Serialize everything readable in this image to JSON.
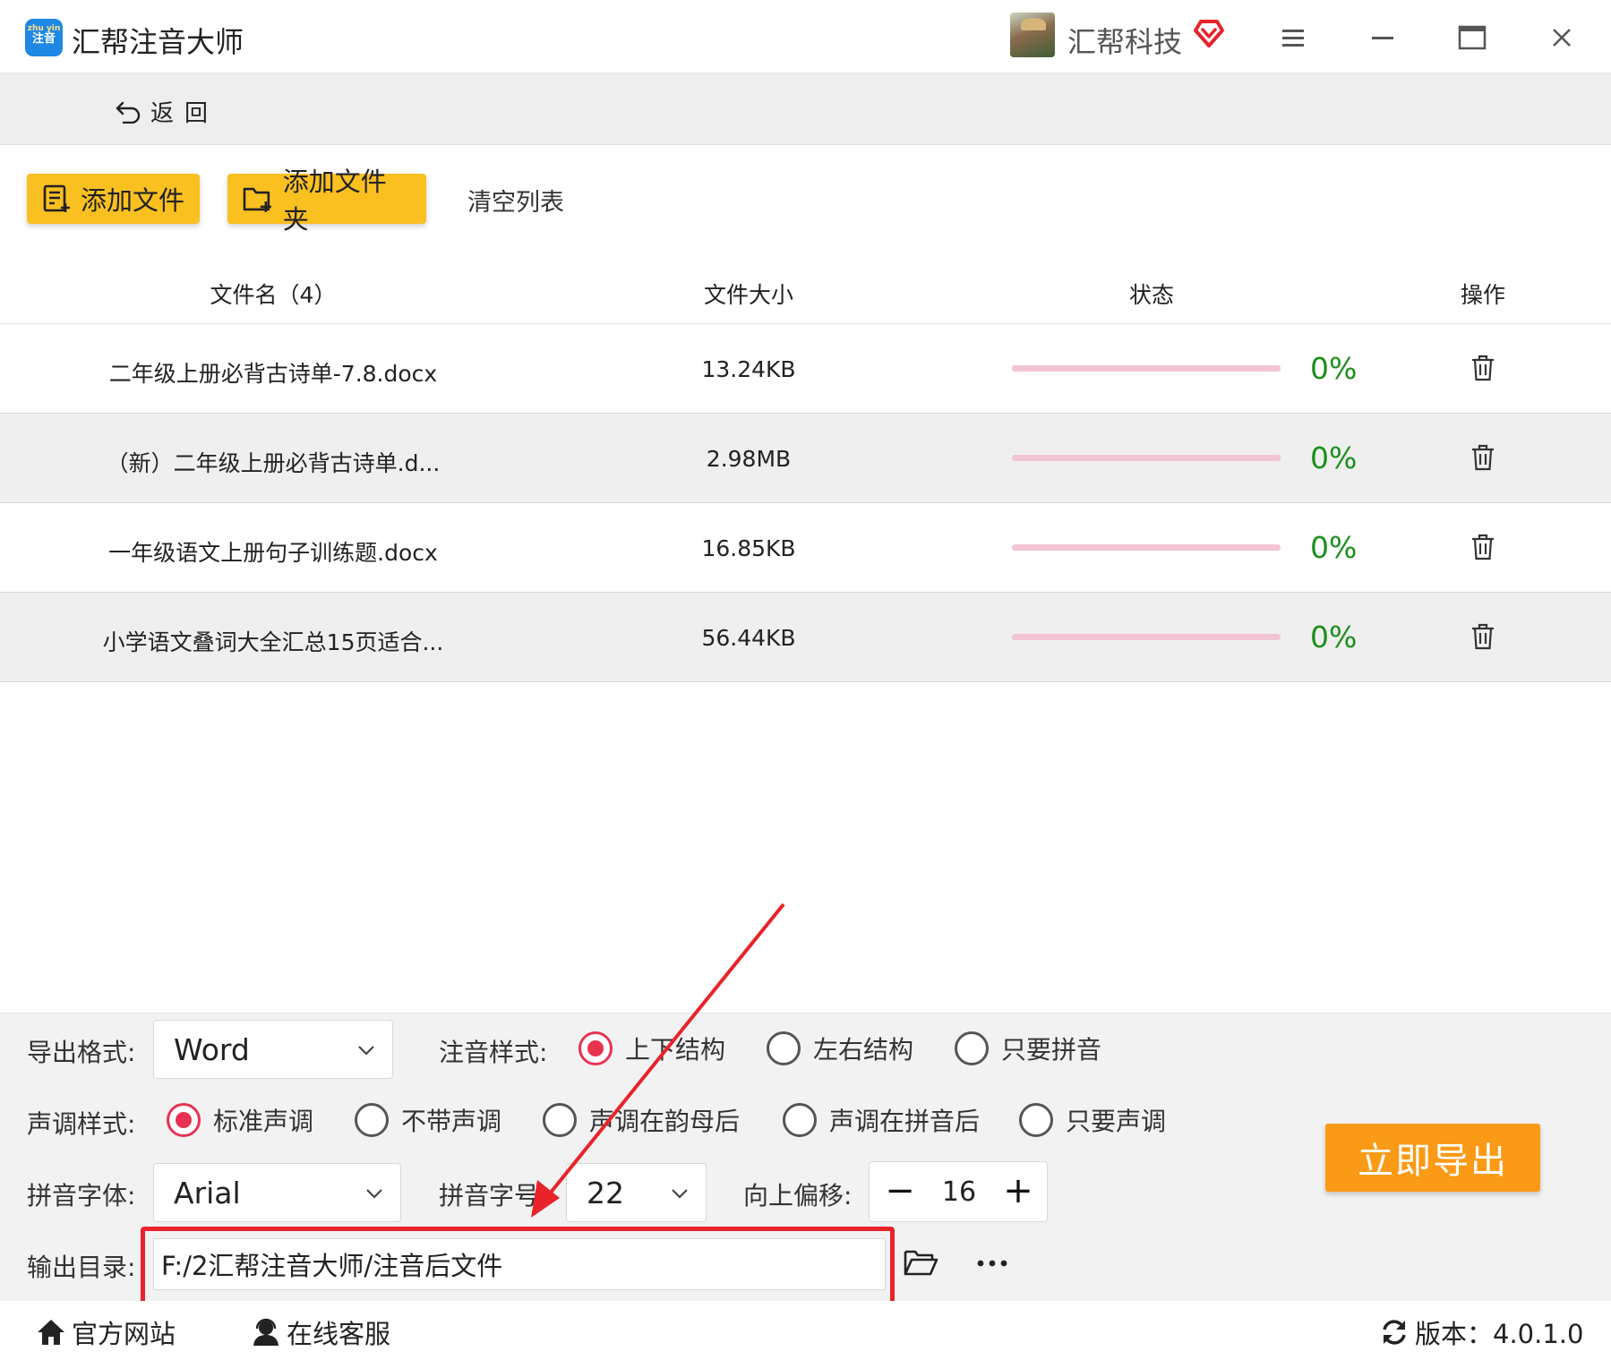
{
  "app": {
    "title": "汇帮注音大师",
    "logo_top": "zhu yin",
    "logo_text": "注音",
    "company": "汇帮科技"
  },
  "nav": {
    "back_label": "返回"
  },
  "toolbar": {
    "add_file": "添加文件",
    "add_folder": "添加文件夹",
    "clear_list": "清空列表"
  },
  "table": {
    "headers": {
      "name": "文件名（4）",
      "size": "文件大小",
      "status": "状态",
      "action": "操作"
    },
    "rows": [
      {
        "name": "二年级上册必背古诗单-7.8.docx",
        "size": "13.24KB",
        "progress": 0,
        "percent": "0%"
      },
      {
        "name": "（新）二年级上册必背古诗单.d...",
        "size": "2.98MB",
        "progress": 0,
        "percent": "0%"
      },
      {
        "name": "一年级语文上册句子训练题.docx",
        "size": "16.85KB",
        "progress": 0,
        "percent": "0%"
      },
      {
        "name": "小学语文叠词大全汇总15页适合...",
        "size": "56.44KB",
        "progress": 0,
        "percent": "0%"
      }
    ]
  },
  "settings": {
    "export_format_label": "导出格式:",
    "export_format_value": "Word",
    "annotation_style_label": "注音样式:",
    "annotation_styles": [
      "上下结构",
      "左右结构",
      "只要拼音"
    ],
    "annotation_style_selected": 0,
    "tone_style_label": "声调样式:",
    "tone_styles": [
      "标准声调",
      "不带声调",
      "声调在韵母后",
      "声调在拼音后",
      "只要声调"
    ],
    "tone_style_selected": 0,
    "pinyin_font_label": "拼音字体:",
    "pinyin_font_value": "Arial",
    "pinyin_size_label": "拼音字号",
    "pinyin_size_value": "22",
    "offset_label": "向上偏移:",
    "offset_value": "16",
    "offset_minus": "−",
    "offset_plus": "+",
    "output_dir_label": "输出目录:",
    "output_dir_value": "F:/2汇帮注音大师/注音后文件",
    "export_button": "立即导出"
  },
  "footer": {
    "website": "官方网站",
    "support": "在线客服",
    "version": "版本：4.0.1.0"
  },
  "colors": {
    "accent_yellow": "#fac020",
    "export_orange": "#fb9a16",
    "radio_red": "#e8324f",
    "percent_green": "#1a8f1a",
    "annotation_red": "#e8232a"
  }
}
